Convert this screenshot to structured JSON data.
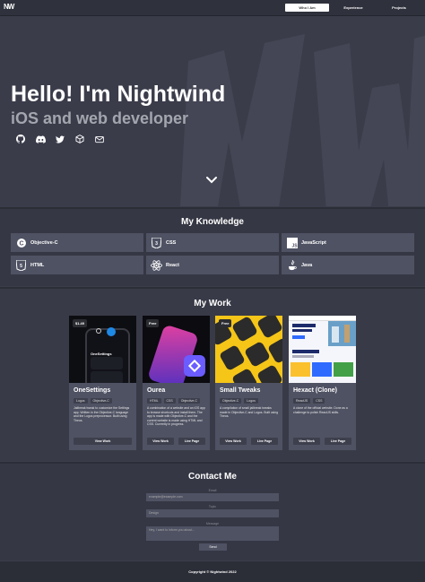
{
  "nav": {
    "logo": "NW",
    "items": [
      "Who I Am",
      "Experience",
      "Projects"
    ]
  },
  "hero": {
    "title": "Hello! I'm Nightwind",
    "subtitle": "iOS and web developer",
    "socials": [
      "github-icon",
      "discord-icon",
      "twitter-icon",
      "package-icon",
      "mail-icon"
    ]
  },
  "knowledge": {
    "title": "My Knowledge",
    "skills": [
      {
        "label": "Objective-C",
        "icon": "objective-c-icon"
      },
      {
        "label": "CSS",
        "icon": "css-icon"
      },
      {
        "label": "JavaScript",
        "icon": "javascript-icon"
      },
      {
        "label": "HTML",
        "icon": "html-icon"
      },
      {
        "label": "React",
        "icon": "react-icon"
      },
      {
        "label": "Java",
        "icon": "java-icon"
      }
    ]
  },
  "work": {
    "title": "My Work",
    "projects": [
      {
        "title": "OneSettings",
        "badge": "$1.49",
        "tags": [
          "Logos",
          "Objective-C"
        ],
        "description": "Jailbreak tweak to customize the Settings app. Written in the Objective-C language and the Logos preprocessor. Built using Theos.",
        "buttons": [
          "View Work"
        ]
      },
      {
        "title": "Ourea",
        "badge": "Free",
        "tags": [
          "HTML",
          "CSS",
          "Objective-C"
        ],
        "description": "A combination of a website and an iOS app to browse shortcuts and install them. The app is made with Objective-C and the current website is made using HTML and CSS. Currently in progress.",
        "buttons": [
          "View Work",
          "Live Page"
        ]
      },
      {
        "title": "Small Tweaks",
        "badge": "Free",
        "tags": [
          "Objective-C",
          "Logos"
        ],
        "description": "A compilation of small jailbreak tweaks made in Objective-C and Logos. Built using Theos.",
        "buttons": [
          "View Work",
          "Live Page"
        ]
      },
      {
        "title": "Hexact (Clone)",
        "badge": "",
        "tags": [
          "ReactJS",
          "CSS"
        ],
        "description": "A clone of the official website. Done as a challenge to polish ReactJS skills.",
        "buttons": [
          "View Work",
          "Live Page"
        ]
      }
    ]
  },
  "contact": {
    "title": "Contact Me",
    "email_label": "Email",
    "email_placeholder": "example@example.com",
    "topic_label": "Topic",
    "topic_placeholder": "Design",
    "message_label": "Message",
    "message_placeholder": "Hey, I want to inform you about...",
    "send_label": "Send"
  },
  "footer": {
    "text": "Copyright © Nightwind 2022"
  },
  "colors": {
    "background": "#3b3d4b",
    "panel": "#4f5263",
    "navbar": "#2f313c"
  }
}
